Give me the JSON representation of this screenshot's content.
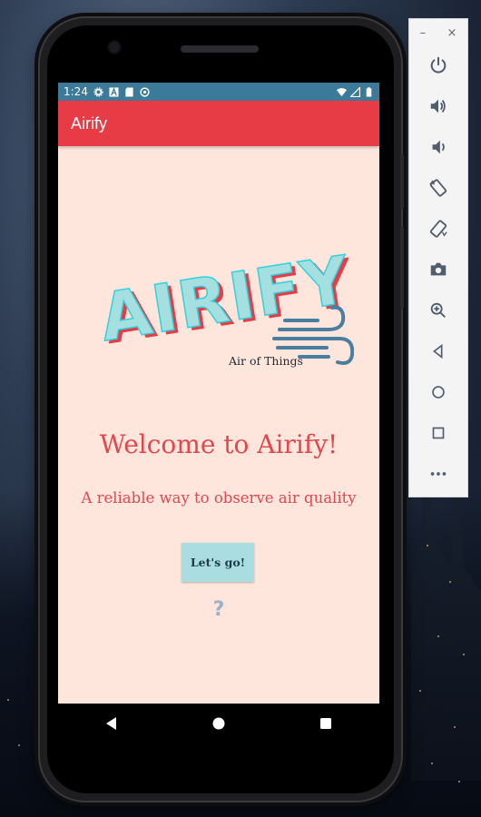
{
  "status_bar": {
    "time": "1:24",
    "left_icons": [
      "gear-icon",
      "font-icon",
      "sd-card-icon",
      "sync-icon"
    ],
    "right_icons": [
      "wifi-icon",
      "signal-icon",
      "battery-icon"
    ]
  },
  "app_bar": {
    "title": "Airify"
  },
  "logo": {
    "wordmark": "AIRIFY",
    "subtitle": "Air of Things"
  },
  "main": {
    "welcome": "Welcome to Airify!",
    "tagline": "A reliable way to observe air quality",
    "cta_label": "Let's go!",
    "help_glyph": "?"
  },
  "colors": {
    "app_bar": "#e73c45",
    "status_bar": "#3c7a9a",
    "screen_bg": "#ffe6dc",
    "accent_text": "#e2474f",
    "button_bg": "#a9dde0"
  },
  "emulator_toolbar": {
    "minimize": "–",
    "close": "×",
    "tools": [
      "power-icon",
      "volume-up-icon",
      "volume-down-icon",
      "rotate-left-icon",
      "rotate-right-icon",
      "camera-icon",
      "zoom-icon",
      "back-icon",
      "home-icon",
      "overview-icon",
      "more-icon"
    ]
  },
  "nav_bar": [
    "back-triangle-icon",
    "home-circle-icon",
    "recents-square-icon"
  ]
}
